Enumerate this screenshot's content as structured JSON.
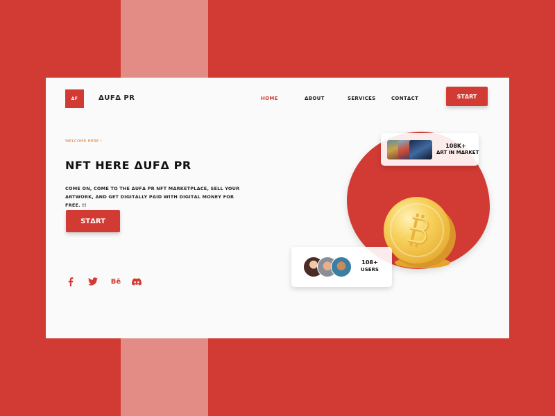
{
  "header": {
    "logo_text": "ΔF",
    "brand": "ΔUFΔ PR",
    "nav": [
      {
        "label": "HOME",
        "active": true
      },
      {
        "label": "ΔBOUT",
        "active": false
      },
      {
        "label": "SERVICES",
        "active": false
      },
      {
        "label": "CONTΔCT",
        "active": false
      }
    ],
    "start_label": "STΔRT"
  },
  "hero": {
    "welcome": "WELCOME HERE !",
    "title": "NFT HERE ΔUFΔ PR",
    "description": "COME ON, COME TO THE ΔUFΔ PR NFT MΔRKETPLΔCE, SELL YOUR ΔRTWORK, ΔND GET DIGITΔLLY PΔID WITH DIGITΔL MONEY FOR FREE. !!",
    "start_label": "STΔRT"
  },
  "social": [
    {
      "icon": "facebook-icon"
    },
    {
      "icon": "twitter-icon"
    },
    {
      "icon": "behance-icon",
      "glyph": "Bē"
    },
    {
      "icon": "discord-icon"
    }
  ],
  "stats": {
    "art": {
      "value": "108K+",
      "label": "ΔRT IN MΔRKET"
    },
    "users": {
      "value": "108+",
      "label": "USERS"
    }
  },
  "colors": {
    "background": "#d13b34",
    "stripe": "#e38c86",
    "card": "#fafafa",
    "accent": "#d13b34",
    "welcome": "#e07a2c",
    "coin": "#f2c548"
  }
}
